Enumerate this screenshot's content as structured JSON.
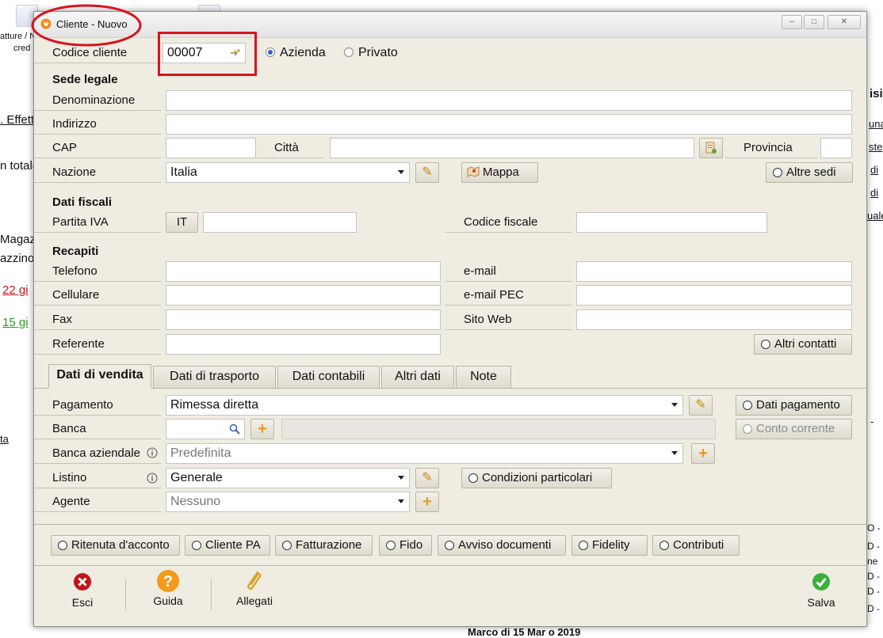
{
  "background": {
    "frag_fatture": "atture / N",
    "frag_cred": "cred",
    "frag_effetti": ". Effetti",
    "frag_totale": "n totale",
    "frag_magaz": "Magaz",
    "frag_azzino": "azzino",
    "frag_22": "22 gi",
    "frag_15": "15 gi",
    "frag_ta": "ta",
    "right_frags": [
      "isi",
      "una",
      "ste",
      "di",
      "di",
      "uale",
      "-",
      "O -",
      "D -",
      "D -",
      "ne",
      "D -",
      "D -"
    ],
    "bottom_text": "Marco  di 15 Mar  o 2019"
  },
  "dialog": {
    "title": "Cliente - Nuovo",
    "window_controls": [
      "minimize",
      "maximize",
      "close"
    ]
  },
  "codice": {
    "label": "Codice cliente",
    "value": "00007",
    "radio_azienda": "Azienda",
    "radio_privato": "Privato",
    "selected": "Azienda"
  },
  "sede": {
    "heading": "Sede legale",
    "denominazione": "Denominazione",
    "indirizzo": "Indirizzo",
    "cap": "CAP",
    "citta": "Città",
    "provincia": "Provincia",
    "nazione": "Nazione",
    "nazione_value": "Italia",
    "mappa": "Mappa",
    "altre_sedi": "Altre sedi"
  },
  "fiscali": {
    "heading": "Dati fiscali",
    "partita_iva": "Partita IVA",
    "country_code": "IT",
    "codice_fiscale": "Codice fiscale"
  },
  "recapiti": {
    "heading": "Recapiti",
    "telefono": "Telefono",
    "cellulare": "Cellulare",
    "fax": "Fax",
    "referente": "Referente",
    "email": "e-mail",
    "email_pec": "e-mail PEC",
    "sito_web": "Sito Web",
    "altri_contatti": "Altri contatti"
  },
  "tabs": [
    {
      "label": "Dati di vendita",
      "active": true
    },
    {
      "label": "Dati di trasporto",
      "active": false
    },
    {
      "label": "Dati contabili",
      "active": false
    },
    {
      "label": "Altri dati",
      "active": false
    },
    {
      "label": "Note",
      "active": false
    }
  ],
  "vendita": {
    "pagamento": "Pagamento",
    "pagamento_value": "Rimessa diretta",
    "dati_pagamento": "Dati pagamento",
    "banca": "Banca",
    "conto_corrente": "Conto corrente",
    "banca_aziendale": "Banca aziendale",
    "banca_aziendale_value": "Predefinita",
    "listino": "Listino",
    "listino_value": "Generale",
    "condizioni": "Condizioni particolari",
    "agente": "Agente",
    "agente_value": "Nessuno"
  },
  "options": [
    "Ritenuta d'acconto",
    "Cliente PA",
    "Fatturazione",
    "Fido",
    "Avviso documenti",
    "Fidelity",
    "Contributi"
  ],
  "footer": {
    "esci": "Esci",
    "guida": "Guida",
    "allegati": "Allegati",
    "salva": "Salva"
  },
  "colors": {
    "dialog_bg": "#efece2",
    "annotation_red": "#d8141c",
    "esci_red": "#c0161c",
    "guida_orange": "#f29a1a",
    "salva_green": "#3bb13b"
  }
}
